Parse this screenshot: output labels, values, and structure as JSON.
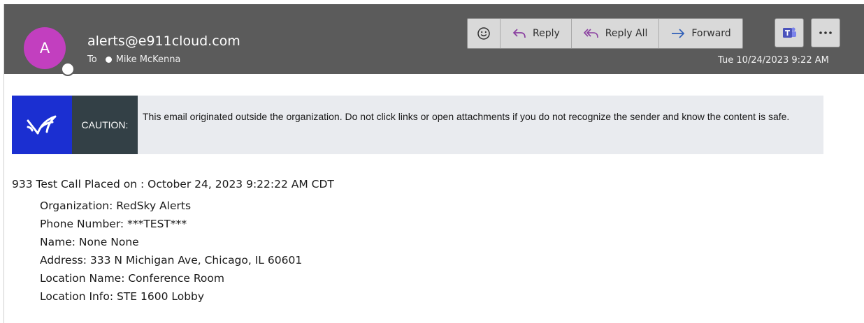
{
  "header": {
    "avatar_letter": "A",
    "sender": "alerts@e911cloud.com",
    "to_label": "To",
    "recipient": "Mike McKenna",
    "date": "Tue 10/24/2023 9:22 AM",
    "actions": {
      "reply": "Reply",
      "reply_all": "Reply All",
      "forward": "Forward"
    },
    "icons": {
      "emoji": "smiley-icon",
      "reply": "reply-arrow-icon",
      "reply_all": "reply-all-arrow-icon",
      "forward": "forward-arrow-icon",
      "teams": "teams-icon",
      "more": "ellipsis-icon"
    },
    "colors": {
      "header_bg": "#5b5b5b",
      "avatar": "#c23fbf",
      "action_bg": "#d9d9d9",
      "accent": "#6264a7"
    }
  },
  "banner": {
    "tag": "CAUTION:",
    "message": "This email originated outside the organization. Do not click links or open attachments if you do not recognize the sender and know the content is safe.",
    "colors": {
      "logo_bg": "#1b2fd1",
      "tag_bg": "#334046",
      "banner_bg": "#e9ebef"
    }
  },
  "body": {
    "first_line": "933 Test Call Placed on : October 24, 2023 9:22:22 AM CDT",
    "details": [
      "Organization: RedSky Alerts",
      "Phone Number: ***TEST***",
      "Name: None None",
      "Address: 333 N Michigan Ave, Chicago, IL 60601",
      "Location Name: Conference Room",
      "Location Info: STE 1600 Lobby"
    ]
  }
}
